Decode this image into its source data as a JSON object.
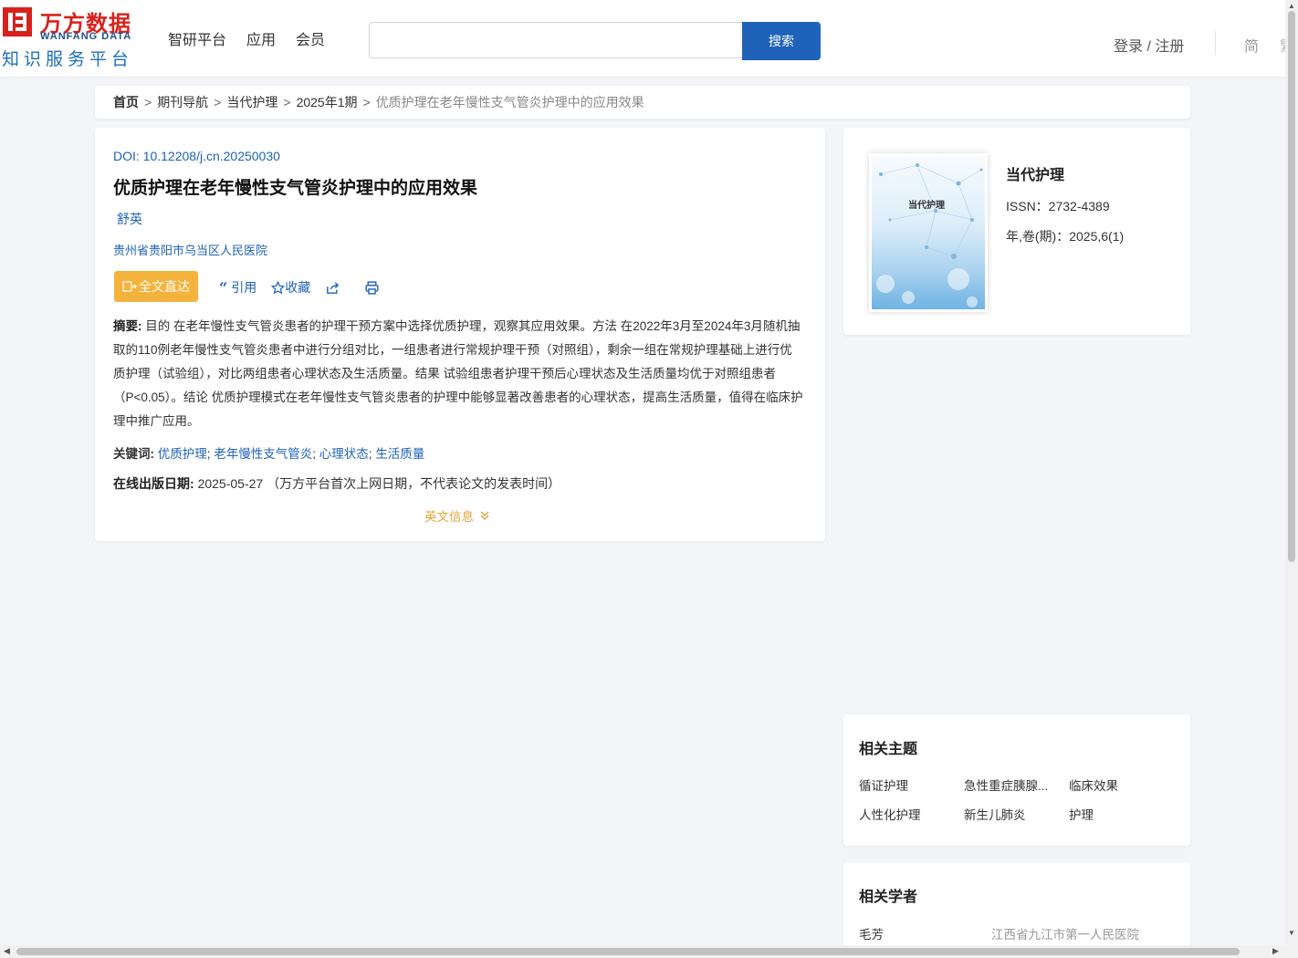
{
  "header": {
    "logo_cn": "万方数据",
    "logo_en": "WANFANG DATA",
    "logo_sub": "知识服务平台",
    "nav": [
      "智研平台",
      "应用",
      "会员"
    ],
    "search_placeholder": "",
    "search_button": "搜索",
    "login": "登录 / 注册",
    "lang": "简",
    "lang2": "繁"
  },
  "breadcrumb": {
    "items": [
      "首页",
      "期刊导航",
      "当代护理",
      "2025年1期"
    ],
    "separator": ">",
    "current": "优质护理在老年慢性支气管炎护理中的应用效果"
  },
  "article": {
    "doi_label": "DOI:",
    "doi": "10.12208/j.cn.20250030",
    "title": "优质护理在老年慢性支气管炎护理中的应用效果",
    "author": "舒英",
    "org": "贵州省贵阳市乌当区人民医院",
    "fulltext_button": "全文直达",
    "cite": "引用",
    "favorite": "收藏",
    "abstract_label": "摘要:",
    "abstract": "目的 在老年慢性支气管炎患者的护理干预方案中选择优质护理，观察其应用效果。方法 在2022年3月至2024年3月随机抽取的110例老年慢性支气管炎患者中进行分组对比，一组患者进行常规护理干预（对照组），剩余一组在常规护理基础上进行优质护理（试验组），对比两组患者心理状态及生活质量。结果 试验组患者护理干预后心理状态及生活质量均优于对照组患者（P<0.05）。结论 优质护理模式在老年慢性支气管炎患者的护理中能够显著改善患者的心理状态，提高生活质量，值得在临床护理中推广应用。",
    "keywords_label": "关键词:",
    "keywords": [
      "优质护理",
      "老年慢性支气管炎",
      "心理状态",
      "生活质量"
    ],
    "pubdate_label": "在线出版日期:",
    "pubdate": "2025-05-27",
    "pubdate_note": "（万方平台首次上网日期，不代表论文的发表时间）",
    "english_info": "英文信息"
  },
  "journal": {
    "cover_title": "当代护理",
    "name": "当代护理",
    "issn": "ISSN：2732-4389",
    "volume": "年,卷(期)：2025,6(1)"
  },
  "related_topics": {
    "title": "相关主题",
    "items": [
      "循证护理",
      "急性重症胰腺...",
      "临床效果",
      "人性化护理",
      "新生儿肺炎",
      "护理"
    ]
  },
  "related_scholars": {
    "title": "相关学者",
    "items": [
      {
        "name": "毛芳",
        "org": "江西省九江市第一人民医院"
      }
    ]
  }
}
